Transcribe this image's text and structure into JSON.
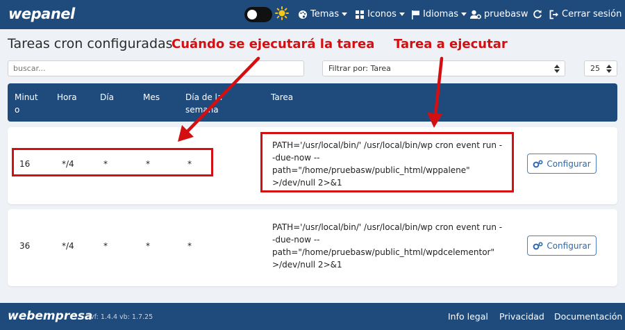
{
  "topbar": {
    "logo": "wepanel",
    "nav": [
      {
        "label": "Temas",
        "icon": "palette-icon",
        "dropdown": true
      },
      {
        "label": "Iconos",
        "icon": "grid-icon",
        "dropdown": true
      },
      {
        "label": "Idiomas",
        "icon": "flag-icon",
        "dropdown": true
      },
      {
        "label": "pruebasw",
        "icon": "user-cog-icon",
        "dropdown": false
      },
      {
        "label": "",
        "icon": "refresh-icon",
        "dropdown": false
      },
      {
        "label": "Cerrar sesión",
        "icon": "logout-icon",
        "dropdown": false
      }
    ]
  },
  "page": {
    "title": "Tareas cron configuradas",
    "annotation_left": "Cuándo se ejecutará la tarea",
    "annotation_right": "Tarea a ejecutar"
  },
  "filters": {
    "search_placeholder": "buscar...",
    "filter_select": "Filtrar por: Tarea",
    "page_size": "25"
  },
  "table": {
    "headers": {
      "minute_1": "Minut",
      "minute_2": "o",
      "hour": "Hora",
      "day": "Día",
      "month": "Mes",
      "weekday_1": "Día de la",
      "weekday_2": "semana",
      "task": "Tarea"
    },
    "rows": [
      {
        "minute": "16",
        "hour": "*/4",
        "day": "*",
        "month": "*",
        "weekday": "*",
        "task_lines": [
          "PATH='/usr/local/bin/' /usr/local/bin/wp cron event run -",
          "-due-now --",
          "path=\"/home/pruebasw/public_html/wppalene\"",
          ">/dev/null 2>&1"
        ],
        "button": "Configurar"
      },
      {
        "minute": "36",
        "hour": "*/4",
        "day": "*",
        "month": "*",
        "weekday": "*",
        "task_lines": [
          "PATH='/usr/local/bin/' /usr/local/bin/wp cron event run -",
          "-due-now --",
          "path=\"/home/pruebasw/public_html/wpdcelementor\"",
          ">/dev/null 2>&1"
        ],
        "button": "Configurar"
      }
    ]
  },
  "footer": {
    "logo": "webempresa",
    "version": "vf: 1.4.4 vb: 1.7.25",
    "links": [
      "Info legal",
      "Privacidad",
      "Documentación"
    ]
  },
  "colors": {
    "primary": "#1f4a7c",
    "accent_red": "#d40f12",
    "button_blue": "#2c68b0"
  }
}
